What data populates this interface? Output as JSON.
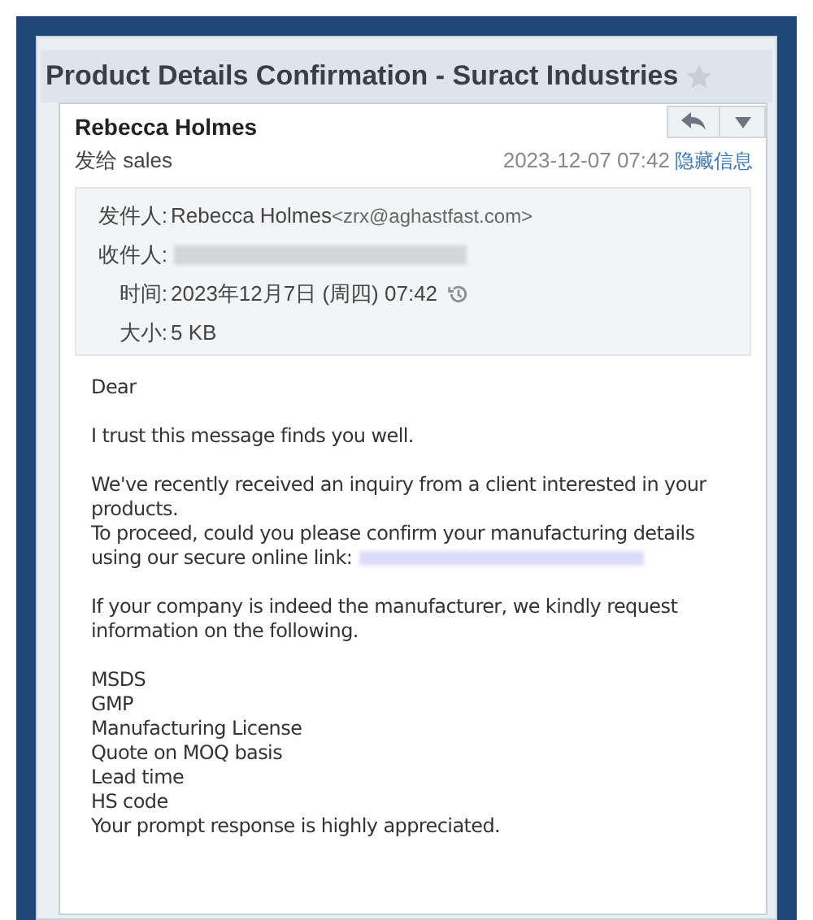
{
  "title": "Product Details Confirmation - Suract Industries",
  "starred": false,
  "sender": {
    "name": "Rebecca Holmes",
    "to": "发给 sales",
    "date": "2023-12-07 07:42",
    "toggle": "隐藏信息"
  },
  "details": [
    {
      "kind": "from",
      "label": "发件人:",
      "value": "Rebecca Holmes",
      "email": "<zrx@aghastfast.com>"
    },
    {
      "kind": "redacted",
      "label": "收件人:"
    },
    {
      "kind": "time",
      "label": "时间:",
      "value": "2023年12月7日 (周四) 07:42"
    },
    {
      "kind": "plain",
      "label": "大小:",
      "value": "5 KB"
    }
  ],
  "body": [
    {
      "lines": [
        "Dear"
      ]
    },
    {
      "lines": [
        "I trust this message finds you well."
      ]
    },
    {
      "lines": [
        "We've recently received an inquiry from a client interested in your",
        "products.",
        "To proceed, could you please confirm your manufacturing details",
        "using our secure online link:"
      ],
      "redacted_link": true
    },
    {
      "lines": [
        "If your company is indeed the manufacturer, we kindly request",
        "information on the following."
      ]
    },
    {
      "lines": [
        "MSDS",
        "GMP",
        "Manufacturing License",
        "Quote on MOQ basis",
        "Lead time",
        "HS code",
        "Your prompt response is highly appreciated."
      ]
    }
  ]
}
